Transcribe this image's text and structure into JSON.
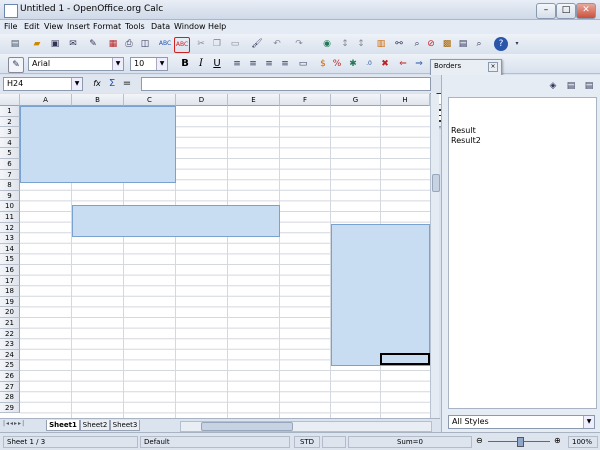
{
  "window": {
    "title": "Untitled 1 - OpenOffice.org Calc",
    "min": "–",
    "max": "□",
    "close": "✕"
  },
  "menu": [
    "File",
    "Edit",
    "View",
    "Insert",
    "Format",
    "Tools",
    "Data",
    "Window",
    "Help"
  ],
  "formatting": {
    "font_name": "Arial",
    "font_size": "10",
    "bold": "B",
    "italic": "I",
    "underline": "U"
  },
  "formula_bar": {
    "cell_ref": "H24",
    "fx": "fx",
    "sum": "Σ",
    "equals": "=",
    "value": ""
  },
  "columns": [
    "A",
    "B",
    "C",
    "D",
    "E",
    "F",
    "G",
    "H"
  ],
  "rows": [
    "1",
    "2",
    "3",
    "4",
    "5",
    "6",
    "7",
    "8",
    "9",
    "10",
    "11",
    "12",
    "13",
    "14",
    "15",
    "16",
    "17",
    "18",
    "19",
    "20",
    "21",
    "22",
    "23",
    "24",
    "25",
    "26",
    "27",
    "28",
    "29"
  ],
  "sheet_tabs": [
    "Sheet1",
    "Sheet2",
    "Sheet3"
  ],
  "borders_popup": {
    "title": "Borders"
  },
  "styles_panel": {
    "items": [
      "Result",
      "Result2"
    ],
    "filter": "All Styles"
  },
  "status": {
    "sheet": "Sheet 1 / 3",
    "style": "Default",
    "mode": "STD",
    "sum": "Sum=0",
    "zoom": "100%"
  }
}
